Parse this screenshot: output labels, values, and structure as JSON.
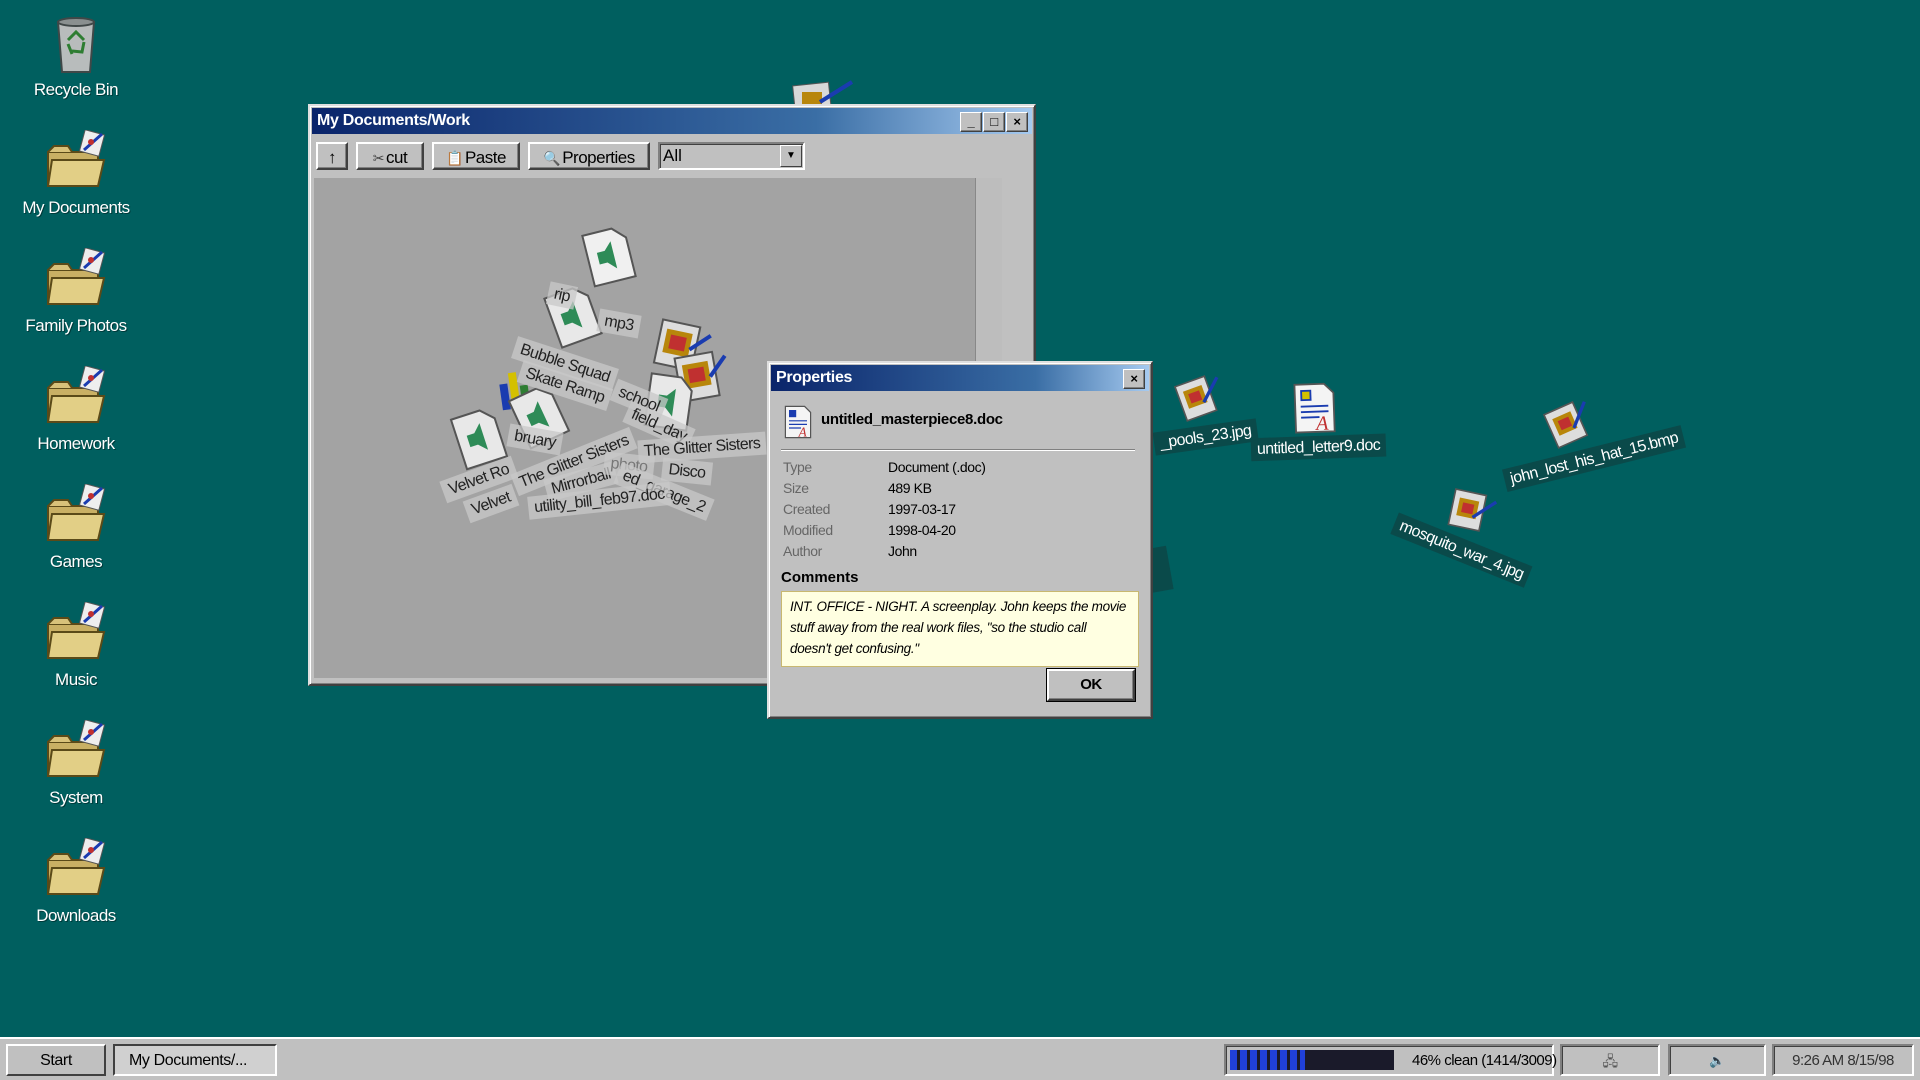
{
  "desktop_icons": [
    {
      "label": "Recycle Bin",
      "icon": "recycle-bin-icon"
    },
    {
      "label": "My Documents",
      "icon": "folder-icon"
    },
    {
      "label": "Family Photos",
      "icon": "folder-icon"
    },
    {
      "label": "Homework",
      "icon": "folder-icon"
    },
    {
      "label": "Games",
      "icon": "folder-icon"
    },
    {
      "label": "Music",
      "icon": "folder-icon"
    },
    {
      "label": "System",
      "icon": "folder-icon"
    },
    {
      "label": "Downloads",
      "icon": "folder-icon"
    }
  ],
  "explorer": {
    "title": "My Documents/Work",
    "toolbar": {
      "up_label": "↑",
      "cut_label": "cut",
      "paste_label": "Paste",
      "properties_label": "Properties",
      "filter_value": "All"
    },
    "pile_labels": [
      "rip",
      "mp3",
      "Bubble Squad",
      "Skate Ramp",
      "school",
      "field_day",
      "bruary",
      "The Glitter Sisters",
      "The Glitter Sisters",
      "Mirrorball",
      "photo",
      "Disco",
      "ed_garage_2",
      "Velvet Ro",
      "Velvet",
      "utility_bill_feb97.doc"
    ]
  },
  "desktop_files": [
    {
      "label": "_pools_23.jpg",
      "icon": "image-file-icon"
    },
    {
      "label": "untitled_letter9.doc",
      "icon": "doc-file-icon"
    },
    {
      "label": "john_lost_his_hat_15.bmp",
      "icon": "image-file-icon"
    },
    {
      "label": "mosquito_war_4.jpg",
      "icon": "image-file-icon"
    }
  ],
  "properties": {
    "title": "Properties",
    "filename": "untitled_masterpiece8.doc",
    "rows": [
      {
        "key": "Type",
        "value": "Document (.doc)"
      },
      {
        "key": "Size",
        "value": "489 KB"
      },
      {
        "key": "Created",
        "value": "1997-03-17"
      },
      {
        "key": "Modified",
        "value": "1998-04-20"
      },
      {
        "key": "Author",
        "value": "John"
      }
    ],
    "comments_label": "Comments",
    "comments": "INT. OFFICE - NIGHT. A screenplay. John keeps the movie stuff away from the real work files, \"so the studio call doesn't get confusing.\"",
    "ok_label": "OK"
  },
  "taskbar": {
    "start_label": "Start",
    "task_label": "My Documents/...",
    "progress_text": "46% clean (1414/3009)",
    "progress_fraction": 0.46,
    "clock": "9:26 AM 8/15/98"
  }
}
